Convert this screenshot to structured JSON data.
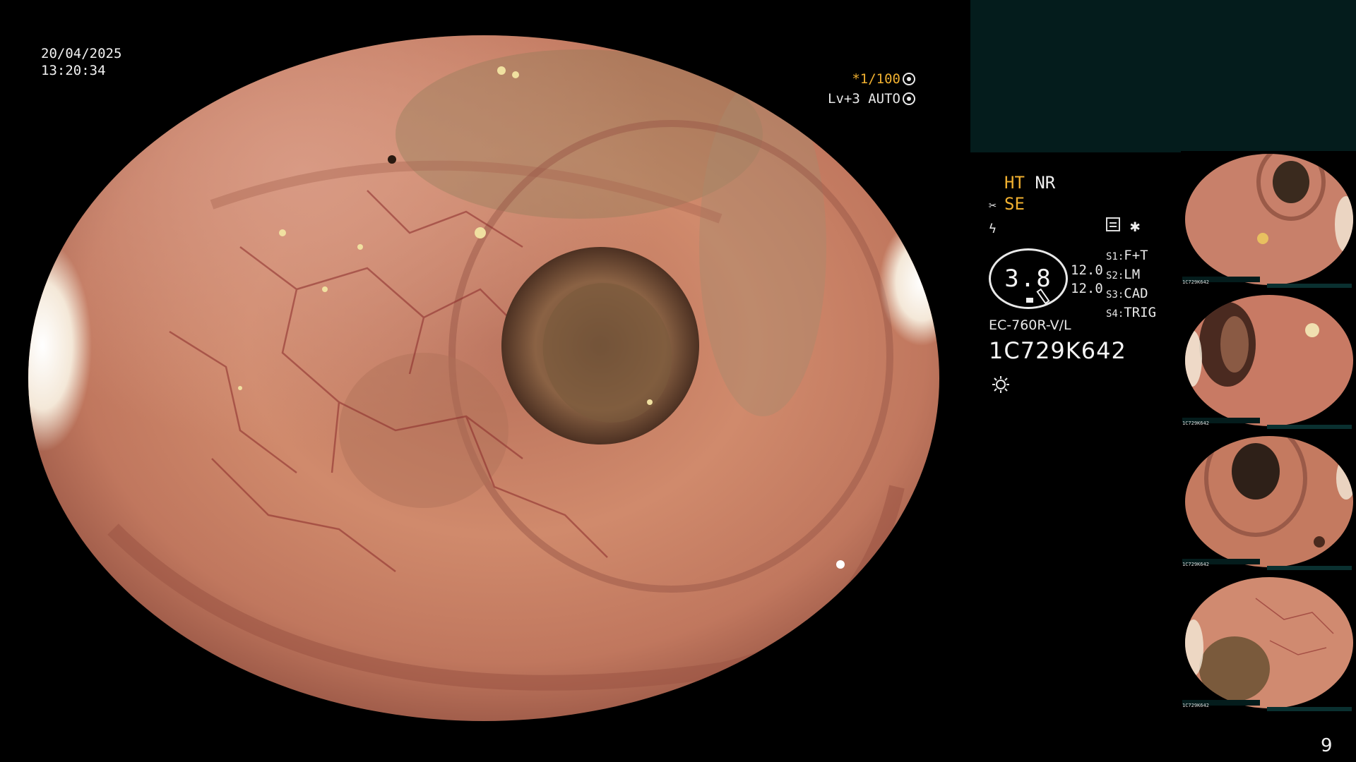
{
  "overlay": {
    "date": "20/04/2025",
    "time": "13:20:34",
    "shutter_value": "*1/100",
    "level_value": "Lv+3 AUTO"
  },
  "mode": {
    "ht": "HT",
    "nr": "NR",
    "se": "SE"
  },
  "gauge": {
    "value": "3.8",
    "upper": "12.0",
    "lower": "12.0"
  },
  "presets": [
    {
      "key": "S1",
      "value": "F+T"
    },
    {
      "key": "S2",
      "value": "LM"
    },
    {
      "key": "S3",
      "value": "CAD"
    },
    {
      "key": "S4",
      "value": "TRIG"
    }
  ],
  "scope": {
    "model": "EC-760R-V/L",
    "serial": "1C729K642"
  },
  "thumbnails": [
    {
      "serial": "1C729K642"
    },
    {
      "serial": "1C729K642"
    },
    {
      "serial": "1C729K642"
    },
    {
      "serial": "1C729K642"
    }
  ],
  "page": {
    "number": "9"
  },
  "colors": {
    "accent_amber": "#f0b030",
    "panel_teal": "#041c1c",
    "mucosa": "#c8785a"
  },
  "icons": [
    "shutter-icon",
    "auto-icon",
    "record-icon",
    "star-icon",
    "light-icon",
    "scissor-icon",
    "flash-icon"
  ]
}
